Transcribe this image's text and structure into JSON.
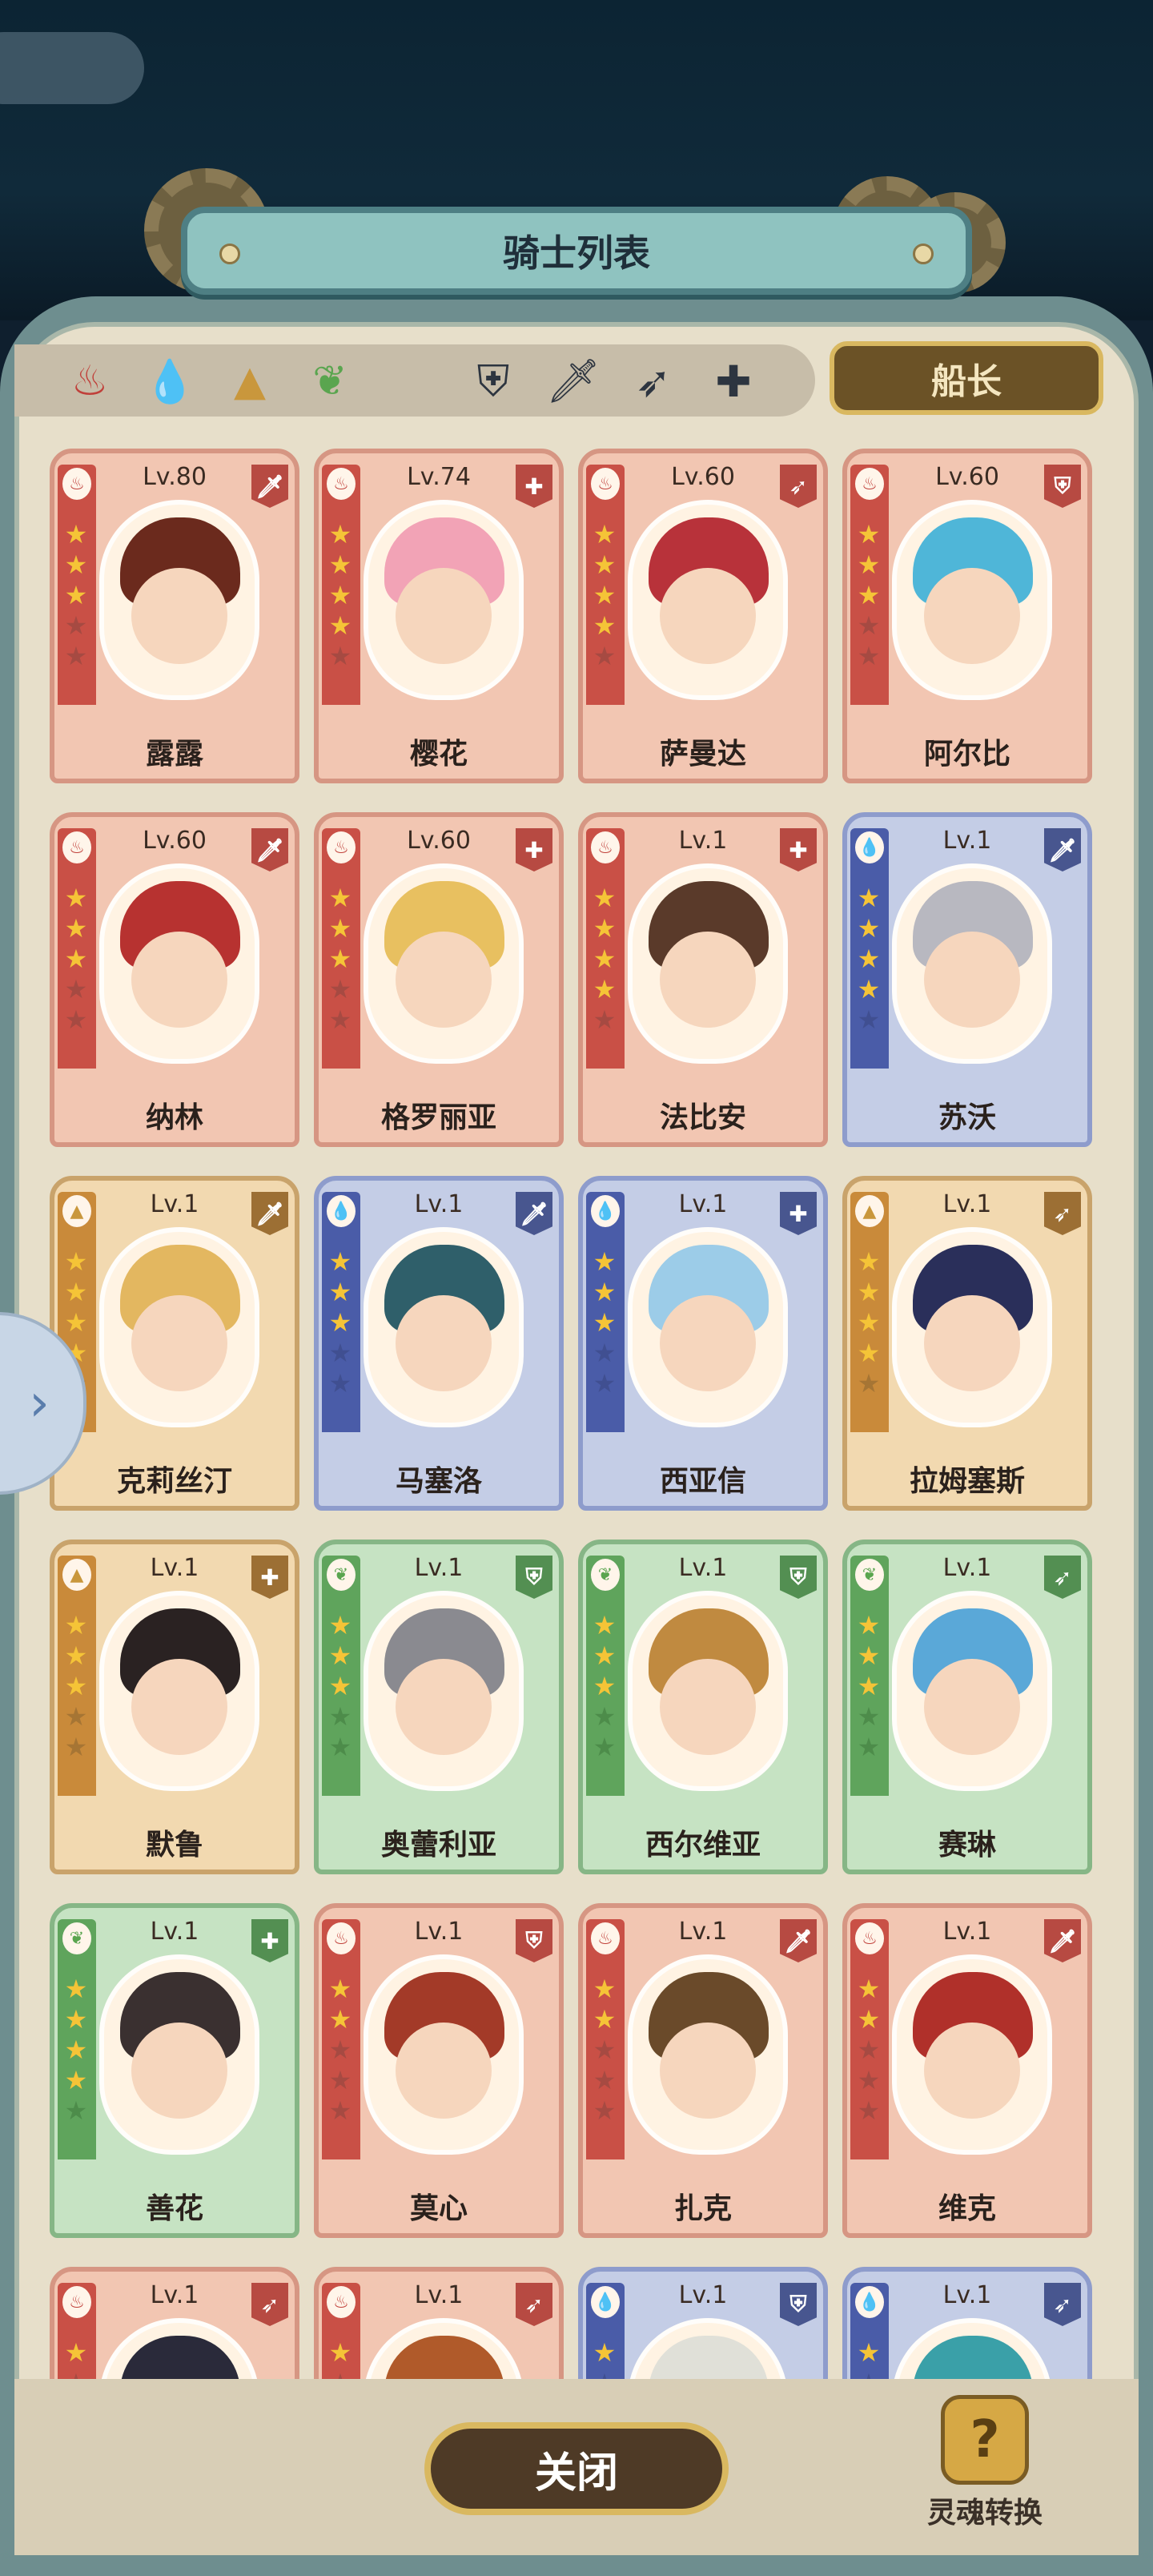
{
  "header": {
    "title": "骑士列表"
  },
  "filters": {
    "elements": [
      {
        "icon": "fire-element-icon",
        "glyph": "♨",
        "color": "#c0403a"
      },
      {
        "icon": "water-element-icon",
        "glyph": "💧",
        "color": "#4b6bc4"
      },
      {
        "icon": "earth-element-icon",
        "glyph": "▲",
        "color": "#c9973c"
      },
      {
        "icon": "wind-element-icon",
        "glyph": "❦",
        "color": "#5aa54f"
      }
    ],
    "classes": [
      {
        "icon": "shield-class-icon",
        "glyph": "⛨"
      },
      {
        "icon": "sword-class-icon",
        "glyph": "🗡"
      },
      {
        "icon": "bow-class-icon",
        "glyph": "➶"
      },
      {
        "icon": "healer-class-icon",
        "glyph": "✚"
      }
    ]
  },
  "captain_button": {
    "label": "船长"
  },
  "knights": [
    {
      "name": "露露",
      "level": "Lv.80",
      "element": "fire",
      "stars": 3,
      "class_glyph": "🗡",
      "hair": "#6b2a1d"
    },
    {
      "name": "樱花",
      "level": "Lv.74",
      "element": "fire",
      "stars": 4,
      "class_glyph": "✚",
      "hair": "#f2a3b6"
    },
    {
      "name": "萨曼达",
      "level": "Lv.60",
      "element": "fire",
      "stars": 4,
      "class_glyph": "➶",
      "hair": "#b8323a"
    },
    {
      "name": "阿尔比",
      "level": "Lv.60",
      "element": "fire",
      "stars": 3,
      "class_glyph": "⛨",
      "hair": "#4fb6d8"
    },
    {
      "name": "纳林",
      "level": "Lv.60",
      "element": "fire",
      "stars": 3,
      "class_glyph": "🗡",
      "hair": "#b73230"
    },
    {
      "name": "格罗丽亚",
      "level": "Lv.60",
      "element": "fire",
      "stars": 3,
      "class_glyph": "✚",
      "hair": "#e8c060"
    },
    {
      "name": "法比安",
      "level": "Lv.1",
      "element": "fire",
      "stars": 4,
      "class_glyph": "✚",
      "hair": "#5a3a2a"
    },
    {
      "name": "苏沃",
      "level": "Lv.1",
      "element": "water",
      "stars": 4,
      "class_glyph": "🗡",
      "hair": "#b8b8c0"
    },
    {
      "name": "克莉丝汀",
      "level": "Lv.1",
      "element": "earth",
      "stars": 4,
      "class_glyph": "🗡",
      "hair": "#e3b760"
    },
    {
      "name": "马塞洛",
      "level": "Lv.1",
      "element": "water",
      "stars": 3,
      "class_glyph": "🗡",
      "hair": "#2f5f6a"
    },
    {
      "name": "西亚信",
      "level": "Lv.1",
      "element": "water",
      "stars": 3,
      "class_glyph": "✚",
      "hair": "#9ccce8"
    },
    {
      "name": "拉姆塞斯",
      "level": "Lv.1",
      "element": "earth",
      "stars": 4,
      "class_glyph": "➶",
      "hair": "#2a2f5a"
    },
    {
      "name": "默鲁",
      "level": "Lv.1",
      "element": "earth",
      "stars": 3,
      "class_glyph": "✚",
      "hair": "#2a2222"
    },
    {
      "name": "奥蕾利亚",
      "level": "Lv.1",
      "element": "wind",
      "stars": 3,
      "class_glyph": "⛨",
      "hair": "#8a8a90"
    },
    {
      "name": "西尔维亚",
      "level": "Lv.1",
      "element": "wind",
      "stars": 3,
      "class_glyph": "⛨",
      "hair": "#c08a40"
    },
    {
      "name": "赛琳",
      "level": "Lv.1",
      "element": "wind",
      "stars": 3,
      "class_glyph": "➶",
      "hair": "#5aa8d8"
    },
    {
      "name": "善花",
      "level": "Lv.1",
      "element": "wind",
      "stars": 4,
      "class_glyph": "✚",
      "hair": "#3a3030"
    },
    {
      "name": "莫心",
      "level": "Lv.1",
      "element": "fire",
      "stars": 2,
      "class_glyph": "⛨",
      "hair": "#a33a28"
    },
    {
      "name": "扎克",
      "level": "Lv.1",
      "element": "fire",
      "stars": 2,
      "class_glyph": "🗡",
      "hair": "#6a4a2a"
    },
    {
      "name": "维克",
      "level": "Lv.1",
      "element": "fire",
      "stars": 2,
      "class_glyph": "🗡",
      "hair": "#b0302a"
    },
    {
      "name": "",
      "level": "Lv.1",
      "element": "fire",
      "stars": 1,
      "class_glyph": "➶",
      "hair": "#2a2a3a"
    },
    {
      "name": "",
      "level": "Lv.1",
      "element": "fire",
      "stars": 1,
      "class_glyph": "➶",
      "hair": "#b05a2a"
    },
    {
      "name": "",
      "level": "Lv.1",
      "element": "water",
      "stars": 1,
      "class_glyph": "⛨",
      "hair": "#e0e0d8"
    },
    {
      "name": "",
      "level": "Lv.1",
      "element": "water",
      "stars": 1,
      "class_glyph": "➶",
      "hair": "#3aa0a8"
    }
  ],
  "side_tab": {
    "icon": "chevron-right-icon",
    "glyph": "›"
  },
  "footer": {
    "close_label": "关闭",
    "soul_convert_label": "灵魂转换",
    "soul_icon_glyph": "?"
  }
}
